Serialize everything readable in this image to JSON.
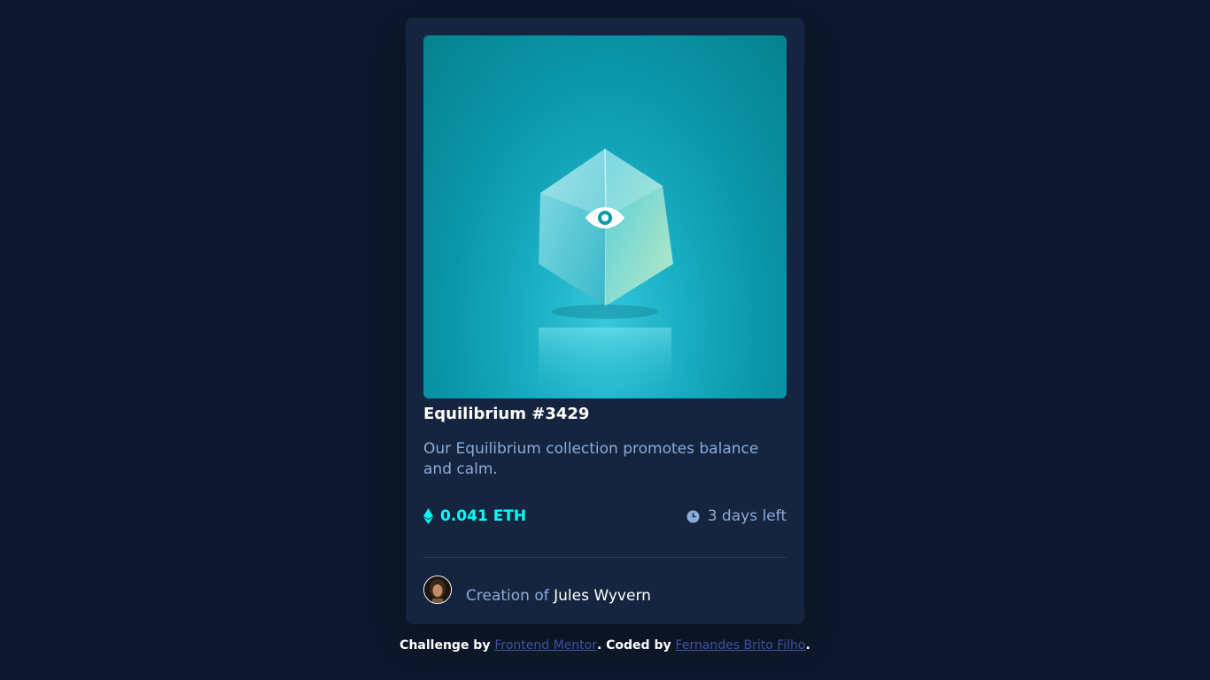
{
  "card": {
    "title": "Equilibrium #3429",
    "description": "Our Equilibrium collection promotes balance and calm.",
    "price": "0.041 ETH",
    "time_left": "3 days left",
    "creator_prefix": "Creation of ",
    "creator_name": "Jules Wyvern"
  },
  "icons": {
    "view": "eye-icon",
    "price": "ethereum-icon",
    "time": "clock-icon"
  },
  "attribution": {
    "prefix": "Challenge by ",
    "challenge_link": "Frontend Mentor",
    "middle": ". Coded by ",
    "author_link": "Fernandes Brito Filho",
    "suffix": "."
  },
  "colors": {
    "page_bg": "#0d192b",
    "card_bg": "#15243f",
    "accent_cyan": "#00fff8",
    "soft_blue": "#8bacd9",
    "link": "#3e52a3"
  }
}
